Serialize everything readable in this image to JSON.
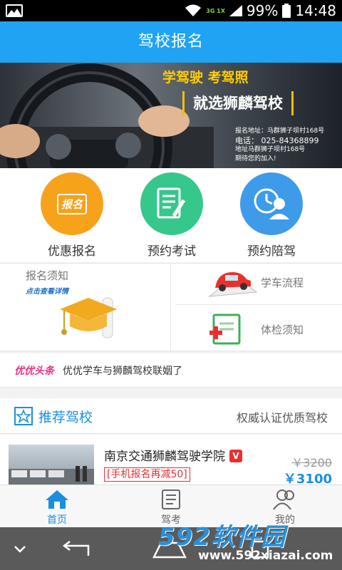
{
  "status_bar": {
    "network": "3G 1X",
    "battery": "99%",
    "time": "14:48"
  },
  "header": {
    "title": "驾校报名"
  },
  "banner": {
    "slogan": "学驾驶 考驾照",
    "headline": "就选狮麟驾校",
    "info_lines": [
      "报名地址：马群狮子坝村168号",
      "电话： 025-84368899",
      "地址马群狮子坝村168号",
      "期待您的加入!"
    ]
  },
  "quick_actions": [
    {
      "label": "优惠报名",
      "badge": "报名",
      "color": "#f7a21b"
    },
    {
      "label": "预约考试",
      "color": "#35c78b"
    },
    {
      "label": "预约陪驾",
      "color": "#3d9bea"
    }
  ],
  "info_grid": {
    "notice_title": "报名须知",
    "notice_sub": "点击查看详情",
    "cells": [
      {
        "label": "学车流程"
      },
      {
        "label": "体检须知"
      }
    ]
  },
  "news": {
    "tag": "优优头条",
    "text": "优优学车与狮麟驾校联姻了"
  },
  "recommend": {
    "title": "推荐驾校",
    "subtitle": "权威认证优质驾校"
  },
  "school": {
    "name": "南京交通狮麟驾驶学院",
    "verified_badge": "V",
    "promo": "[手机报名再减50]",
    "original_price": "￥3200",
    "price": "￥3100"
  },
  "tabs": [
    {
      "label": "首页",
      "active": true
    },
    {
      "label": "驾考"
    },
    {
      "label": "我的"
    }
  ],
  "watermark": {
    "brand": "592软件园",
    "url": "www.592xiazai.com"
  },
  "colors": {
    "primary": "#1fa3f2",
    "accent_red": "#e8312e",
    "pink": "#e8338a"
  }
}
